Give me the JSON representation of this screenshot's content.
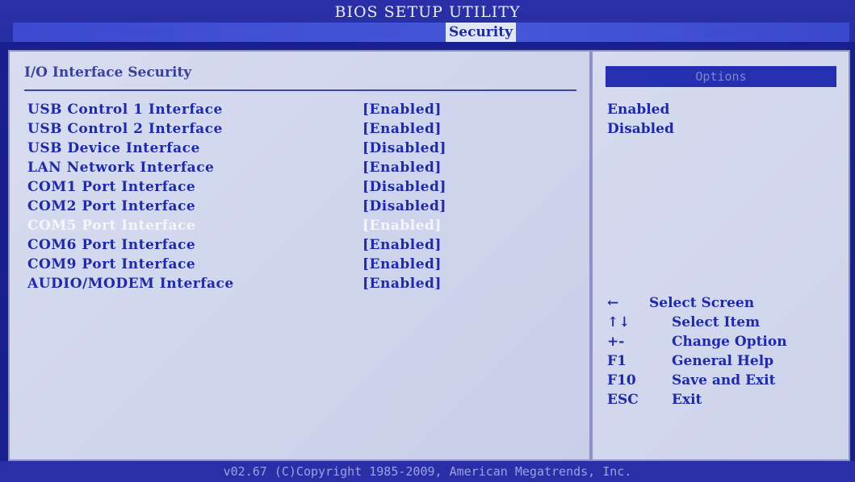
{
  "header": {
    "title": "BIOS SETUP UTILITY",
    "active_tab": "Security"
  },
  "main": {
    "section_title": "I/O Interface Security",
    "settings": [
      {
        "label": "USB Control 1 Interface",
        "value": "[Enabled]"
      },
      {
        "label": "USB Control 2 Interface",
        "value": "[Enabled]"
      },
      {
        "label": "USB Device Interface",
        "value": "[Disabled]"
      },
      {
        "label": "LAN Network Interface",
        "value": "[Enabled]"
      },
      {
        "label": "COM1 Port Interface",
        "value": "[Disabled]"
      },
      {
        "label": "COM2 Port Interface",
        "value": "[Disabled]"
      },
      {
        "label": "COM5 Port Interface",
        "value": "[Enabled]"
      },
      {
        "label": "COM6 Port Interface",
        "value": "[Enabled]"
      },
      {
        "label": "COM9 Port Interface",
        "value": "[Enabled]"
      },
      {
        "label": "AUDIO/MODEM Interface",
        "value": "[Enabled]"
      }
    ]
  },
  "options": {
    "header": "Options",
    "items": [
      "Enabled",
      "Disabled"
    ]
  },
  "help": [
    {
      "key": "←",
      "desc": "Select Screen"
    },
    {
      "key": "↑↓",
      "desc": "Select Item"
    },
    {
      "key": "+-",
      "desc": "Change Option"
    },
    {
      "key": "F1",
      "desc": "General Help"
    },
    {
      "key": "F10",
      "desc": "Save and Exit"
    },
    {
      "key": "ESC",
      "desc": "Exit"
    }
  ],
  "footer": {
    "text": "v02.67 (C)Copyright 1985-2009, American Megatrends, Inc."
  },
  "colors": {
    "background": "#1a1f8f",
    "panel": "#d6dbee",
    "text": "#1f2aa8",
    "highlight_text": "#f4f6fb"
  }
}
